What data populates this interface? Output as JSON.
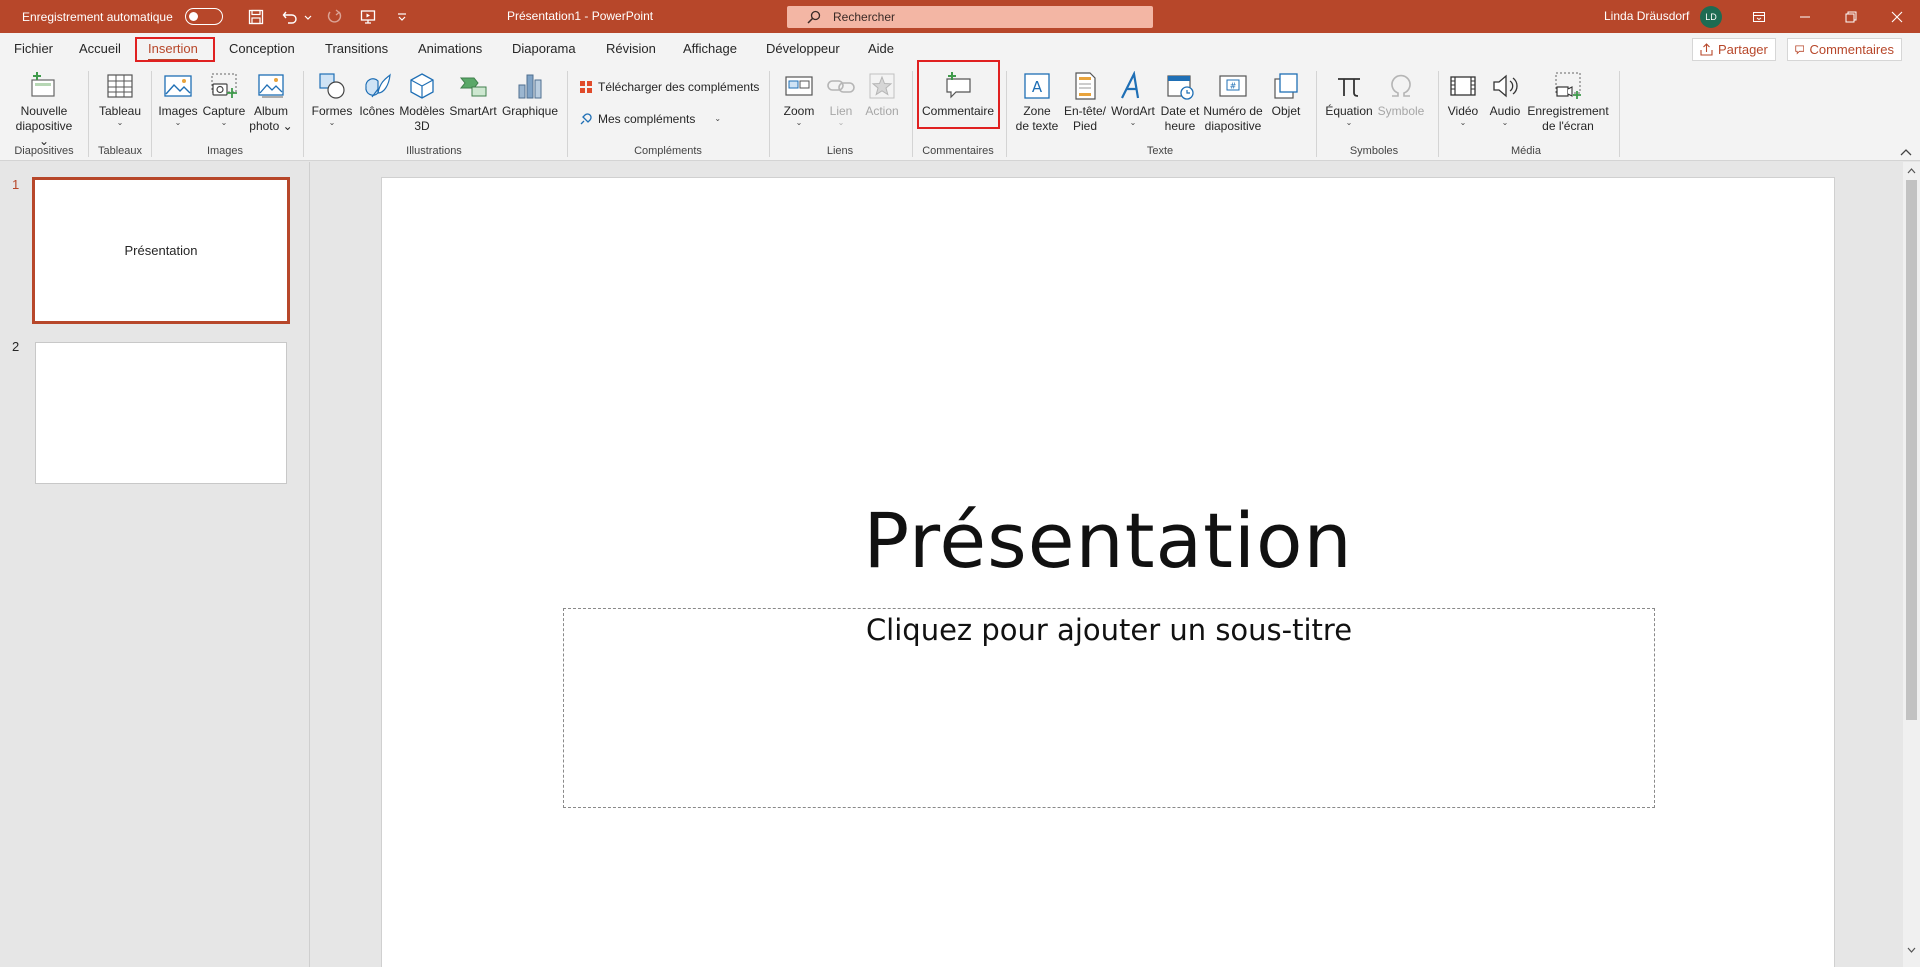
{
  "titlebar": {
    "autosave_label": "Enregistrement automatique",
    "doc_title": "Présentation1  -  PowerPoint",
    "search_placeholder": "Rechercher",
    "user_name": "Linda Dräusdorf",
    "user_initials": "LD"
  },
  "tabs": {
    "fichier": "Fichier",
    "accueil": "Accueil",
    "insertion": "Insertion",
    "conception": "Conception",
    "transitions": "Transitions",
    "animations": "Animations",
    "diaporama": "Diaporama",
    "revision": "Révision",
    "affichage": "Affichage",
    "developpeur": "Développeur",
    "aide": "Aide",
    "active": "Insertion"
  },
  "share": {
    "partager": "Partager",
    "commentaires": "Commentaires"
  },
  "ribbon": {
    "nouvelle_diapositive": [
      "Nouvelle",
      "diapositive"
    ],
    "tableau": "Tableau",
    "images": "Images",
    "capture": "Capture",
    "album_photo": [
      "Album",
      "photo"
    ],
    "formes": "Formes",
    "icones": "Icônes",
    "modeles3d": [
      "Modèles",
      "3D"
    ],
    "smartart": "SmartArt",
    "graphique": "Graphique",
    "telecharger": "Télécharger des compléments",
    "mes_complements": "Mes compléments",
    "zoom": "Zoom",
    "lien": "Lien",
    "action": "Action",
    "commentaire": "Commentaire",
    "zone_texte": [
      "Zone",
      "de texte"
    ],
    "entete_pied": [
      "En-tête/",
      "Pied"
    ],
    "wordart": "WordArt",
    "date_heure": [
      "Date et",
      "heure"
    ],
    "numero": [
      "Numéro de",
      "diapositive"
    ],
    "objet": "Objet",
    "equation": "Équation",
    "symbole": "Symbole",
    "video": "Vidéo",
    "audio": "Audio",
    "enregistrement": [
      "Enregistrement",
      "de l'écran"
    ],
    "groups": {
      "diapositives": "Diapositives",
      "tableaux": "Tableaux",
      "images": "Images",
      "illustrations": "Illustrations",
      "complements": "Compléments",
      "liens": "Liens",
      "commentaires": "Commentaires",
      "texte": "Texte",
      "symboles": "Symboles",
      "media": "Média"
    }
  },
  "thumbnails": [
    {
      "number": "1",
      "title": "Présentation",
      "selected": true
    },
    {
      "number": "2",
      "title": "",
      "selected": false
    }
  ],
  "slide": {
    "title": "Présentation",
    "subtitle_placeholder": "Cliquez pour ajouter un sous-titre"
  },
  "colors": {
    "accent": "#b7472a",
    "highlight": "#e02020"
  }
}
